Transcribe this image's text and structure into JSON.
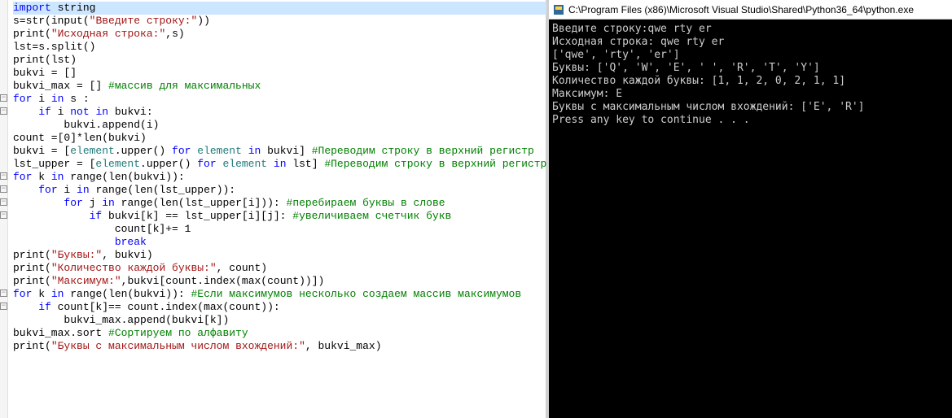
{
  "editor": {
    "lines": [
      {
        "fold": "",
        "tokens": [
          {
            "t": "kw",
            "v": "import"
          },
          {
            "t": "op",
            "v": " string"
          }
        ],
        "hl": true
      },
      {
        "fold": "",
        "tokens": [
          {
            "t": "op",
            "v": "s="
          },
          {
            "t": "fn",
            "v": "str"
          },
          {
            "t": "op",
            "v": "("
          },
          {
            "t": "fn",
            "v": "input"
          },
          {
            "t": "op",
            "v": "("
          },
          {
            "t": "str",
            "v": "\"Введите строку:\""
          },
          {
            "t": "op",
            "v": "))"
          }
        ]
      },
      {
        "fold": "",
        "tokens": [
          {
            "t": "fn",
            "v": "print"
          },
          {
            "t": "op",
            "v": "("
          },
          {
            "t": "str",
            "v": "\"Исходная строка:\""
          },
          {
            "t": "op",
            "v": ",s)"
          }
        ]
      },
      {
        "fold": "",
        "tokens": [
          {
            "t": "op",
            "v": "lst=s.split()"
          }
        ]
      },
      {
        "fold": "",
        "tokens": [
          {
            "t": "fn",
            "v": "print"
          },
          {
            "t": "op",
            "v": "(lst)"
          }
        ]
      },
      {
        "fold": "",
        "tokens": [
          {
            "t": "op",
            "v": "bukvi = []"
          }
        ]
      },
      {
        "fold": "",
        "tokens": [
          {
            "t": "op",
            "v": "bukvi_max = [] "
          },
          {
            "t": "cm",
            "v": "#массив для максимальных"
          }
        ]
      },
      {
        "fold": "-",
        "tokens": [
          {
            "t": "kw",
            "v": "for"
          },
          {
            "t": "op",
            "v": " i "
          },
          {
            "t": "kw",
            "v": "in"
          },
          {
            "t": "op",
            "v": " s :"
          }
        ]
      },
      {
        "fold": "-",
        "tokens": [
          {
            "t": "op",
            "v": "    "
          },
          {
            "t": "kw",
            "v": "if"
          },
          {
            "t": "op",
            "v": " i "
          },
          {
            "t": "kw",
            "v": "not in"
          },
          {
            "t": "op",
            "v": " bukvi:"
          }
        ]
      },
      {
        "fold": "",
        "tokens": [
          {
            "t": "op",
            "v": "        bukvi.append(i)"
          }
        ]
      },
      {
        "fold": "",
        "tokens": [
          {
            "t": "op",
            "v": "count =[0]*"
          },
          {
            "t": "fn",
            "v": "len"
          },
          {
            "t": "op",
            "v": "(bukvi)"
          }
        ]
      },
      {
        "fold": "",
        "tokens": [
          {
            "t": "op",
            "v": "bukvi = ["
          },
          {
            "t": "id",
            "v": "element"
          },
          {
            "t": "op",
            "v": ".upper() "
          },
          {
            "t": "kw",
            "v": "for"
          },
          {
            "t": "op",
            "v": " "
          },
          {
            "t": "id",
            "v": "element"
          },
          {
            "t": "op",
            "v": " "
          },
          {
            "t": "kw",
            "v": "in"
          },
          {
            "t": "op",
            "v": " bukvi] "
          },
          {
            "t": "cm",
            "v": "#Переводим строку в верхний регистр"
          }
        ]
      },
      {
        "fold": "",
        "tokens": [
          {
            "t": "op",
            "v": "lst_upper = ["
          },
          {
            "t": "id",
            "v": "element"
          },
          {
            "t": "op",
            "v": ".upper() "
          },
          {
            "t": "kw",
            "v": "for"
          },
          {
            "t": "op",
            "v": " "
          },
          {
            "t": "id",
            "v": "element"
          },
          {
            "t": "op",
            "v": " "
          },
          {
            "t": "kw",
            "v": "in"
          },
          {
            "t": "op",
            "v": " lst] "
          },
          {
            "t": "cm",
            "v": "#Переводим строку в верхний регистр"
          }
        ]
      },
      {
        "fold": "-",
        "tokens": [
          {
            "t": "kw",
            "v": "for"
          },
          {
            "t": "op",
            "v": " k "
          },
          {
            "t": "kw",
            "v": "in"
          },
          {
            "t": "op",
            "v": " "
          },
          {
            "t": "fn",
            "v": "range"
          },
          {
            "t": "op",
            "v": "("
          },
          {
            "t": "fn",
            "v": "len"
          },
          {
            "t": "op",
            "v": "(bukvi)):"
          }
        ]
      },
      {
        "fold": "-",
        "tokens": [
          {
            "t": "op",
            "v": "    "
          },
          {
            "t": "kw",
            "v": "for"
          },
          {
            "t": "op",
            "v": " i "
          },
          {
            "t": "kw",
            "v": "in"
          },
          {
            "t": "op",
            "v": " "
          },
          {
            "t": "fn",
            "v": "range"
          },
          {
            "t": "op",
            "v": "("
          },
          {
            "t": "fn",
            "v": "len"
          },
          {
            "t": "op",
            "v": "(lst_upper)):"
          }
        ]
      },
      {
        "fold": "-",
        "tokens": [
          {
            "t": "op",
            "v": "        "
          },
          {
            "t": "kw",
            "v": "for"
          },
          {
            "t": "op",
            "v": " j "
          },
          {
            "t": "kw",
            "v": "in"
          },
          {
            "t": "op",
            "v": " "
          },
          {
            "t": "fn",
            "v": "range"
          },
          {
            "t": "op",
            "v": "("
          },
          {
            "t": "fn",
            "v": "len"
          },
          {
            "t": "op",
            "v": "(lst_upper[i])): "
          },
          {
            "t": "cm",
            "v": "#перебираем буквы в слове"
          }
        ]
      },
      {
        "fold": "-",
        "tokens": [
          {
            "t": "op",
            "v": "            "
          },
          {
            "t": "kw",
            "v": "if"
          },
          {
            "t": "op",
            "v": " bukvi[k] == lst_upper[i][j]: "
          },
          {
            "t": "cm",
            "v": "#увеличиваем счетчик букв"
          }
        ]
      },
      {
        "fold": "",
        "tokens": [
          {
            "t": "op",
            "v": "                count[k]+= 1"
          }
        ]
      },
      {
        "fold": "",
        "tokens": [
          {
            "t": "op",
            "v": "                "
          },
          {
            "t": "kw",
            "v": "break"
          }
        ]
      },
      {
        "fold": "",
        "tokens": [
          {
            "t": "fn",
            "v": "print"
          },
          {
            "t": "op",
            "v": "("
          },
          {
            "t": "str",
            "v": "\"Буквы:\""
          },
          {
            "t": "op",
            "v": ", bukvi)"
          }
        ]
      },
      {
        "fold": "",
        "tokens": [
          {
            "t": "fn",
            "v": "print"
          },
          {
            "t": "op",
            "v": "("
          },
          {
            "t": "str",
            "v": "\"Количество каждой буквы:\""
          },
          {
            "t": "op",
            "v": ", count)"
          }
        ]
      },
      {
        "fold": "",
        "tokens": [
          {
            "t": "fn",
            "v": "print"
          },
          {
            "t": "op",
            "v": "("
          },
          {
            "t": "str",
            "v": "\"Максимум:\""
          },
          {
            "t": "op",
            "v": ",bukvi[count.index("
          },
          {
            "t": "fn",
            "v": "max"
          },
          {
            "t": "op",
            "v": "(count))])"
          }
        ]
      },
      {
        "fold": "-",
        "tokens": [
          {
            "t": "kw",
            "v": "for"
          },
          {
            "t": "op",
            "v": " k "
          },
          {
            "t": "kw",
            "v": "in"
          },
          {
            "t": "op",
            "v": " "
          },
          {
            "t": "fn",
            "v": "range"
          },
          {
            "t": "op",
            "v": "("
          },
          {
            "t": "fn",
            "v": "len"
          },
          {
            "t": "op",
            "v": "(bukvi)): "
          },
          {
            "t": "cm",
            "v": "#Если максимумов несколько создаем массив максимумов"
          }
        ]
      },
      {
        "fold": "-",
        "tokens": [
          {
            "t": "op",
            "v": "    "
          },
          {
            "t": "kw",
            "v": "if"
          },
          {
            "t": "op",
            "v": " count[k]== count.index("
          },
          {
            "t": "fn",
            "v": "max"
          },
          {
            "t": "op",
            "v": "(count)):"
          }
        ]
      },
      {
        "fold": "",
        "tokens": [
          {
            "t": "op",
            "v": "        bukvi_max.append(bukvi[k])"
          }
        ]
      },
      {
        "fold": "",
        "tokens": [
          {
            "t": "op",
            "v": "bukvi_max.sort "
          },
          {
            "t": "cm",
            "v": "#Сортируем по алфавиту"
          }
        ]
      },
      {
        "fold": "",
        "tokens": [
          {
            "t": "fn",
            "v": "print"
          },
          {
            "t": "op",
            "v": "("
          },
          {
            "t": "str",
            "v": "\"Буквы с максимальным числом вхождений:\""
          },
          {
            "t": "op",
            "v": ", bukvi_max)"
          }
        ]
      }
    ]
  },
  "console": {
    "title": "C:\\Program Files (x86)\\Microsoft Visual Studio\\Shared\\Python36_64\\python.exe",
    "lines": [
      "Введите строку:qwe rty er",
      "Исходная строка: qwe rty er",
      "['qwe', 'rty', 'er']",
      "Буквы: ['Q', 'W', 'E', ' ', 'R', 'T', 'Y']",
      "Количество каждой буквы: [1, 1, 2, 0, 2, 1, 1]",
      "Максимум: E",
      "Буквы с максимальным числом вхождений: ['E', 'R']",
      "Press any key to continue . . ."
    ]
  }
}
